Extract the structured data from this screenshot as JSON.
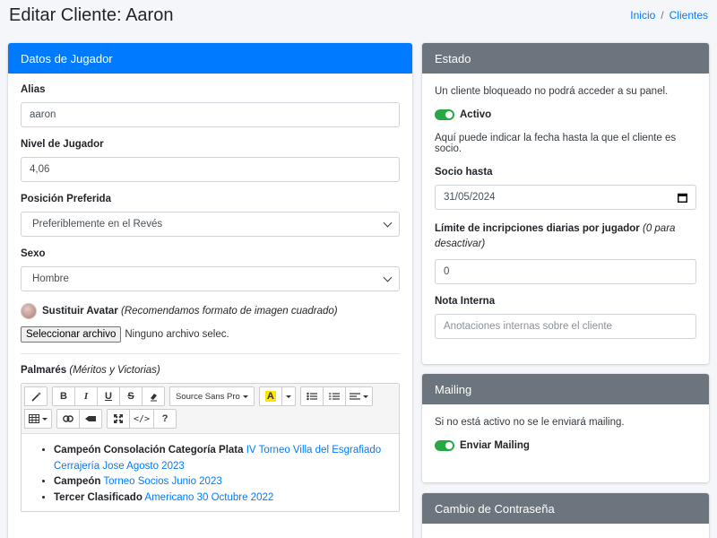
{
  "page": {
    "title": "Editar Cliente: Aaron",
    "breadcrumb": [
      "Inicio",
      "/",
      "Clientes"
    ]
  },
  "player_card": {
    "header": "Datos de Jugador",
    "alias_label": "Alias",
    "alias_value": "aaron",
    "level_label": "Nivel de Jugador",
    "level_value": "4,06",
    "position_label": "Posición Preferida",
    "position_value": "Preferiblemente en el Revés",
    "sex_label": "Sexo",
    "sex_value": "Hombre",
    "avatar_label": "Sustituir Avatar",
    "avatar_hint": "(Recomendamos formato de imagen cuadrado)",
    "file_button": "Seleccionar archivo",
    "file_status": "Ninguno archivo selec.",
    "palmares_label": "Palmarés",
    "palmares_hint": "(Méritos y Victorias)",
    "toolbar": {
      "font": "Source Sans Pro",
      "highlight": "A"
    },
    "palmares": [
      {
        "title": "Campeón Consolación Categoría Plata",
        "link": "IV Torneo Villa del Esgrafiado Cerrajería Jose Agosto 2023"
      },
      {
        "title": "Campeón",
        "link": "Torneo Socios Junio 2023"
      },
      {
        "title": "Tercer Clasificado",
        "link": "Americano 30 Octubre 2022"
      }
    ]
  },
  "estado_card": {
    "header": "Estado",
    "blocked_text": "Un cliente bloqueado no podrá acceder a su panel.",
    "active_label": "Activo",
    "socio_text": "Aquí puede indicar la fecha hasta la que el cliente es socio.",
    "socio_label": "Socio hasta",
    "socio_value": "31/05/2024",
    "limit_label": "Límite de incripciones diarias por jugador",
    "limit_hint": "(0 para desactivar)",
    "limit_value": "0",
    "note_label": "Nota Interna",
    "note_placeholder": "Anotaciones internas sobre el cliente"
  },
  "mailing_card": {
    "header": "Mailing",
    "text": "Si no está activo no se le enviará mailing.",
    "switch_label": "Enviar Mailing"
  },
  "password_card": {
    "header": "Cambio de Contraseña"
  },
  "colors": {
    "primary": "#007bff",
    "secondary": "#6c757d",
    "success": "#28a745"
  }
}
